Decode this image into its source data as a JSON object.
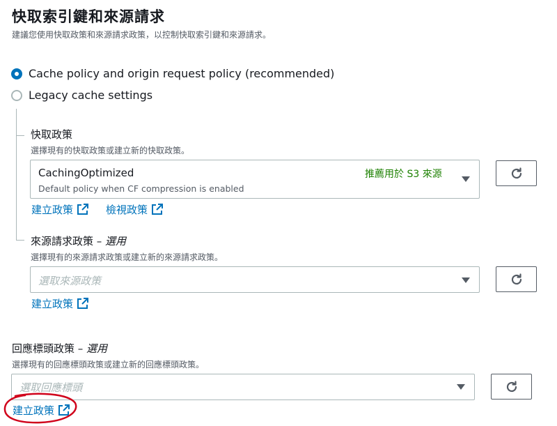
{
  "header": {
    "title": "快取索引鍵和來源請求",
    "description": "建議您使用快取政策和來源請求政策，以控制快取索引鍵和來源請求。"
  },
  "options": {
    "policy_label": "Cache policy and origin request policy (recommended)",
    "legacy_label": "Legacy cache settings",
    "selected": "policy"
  },
  "cache_policy": {
    "label": "快取政策",
    "description": "選擇現有的快取政策或建立新的快取政策。",
    "selected_name": "CachingOptimized",
    "selected_badge": "推薦用於 S3 來源",
    "selected_description": "Default policy when CF compression is enabled",
    "create_link": "建立政策",
    "view_link": "檢視政策"
  },
  "origin_request_policy": {
    "label": "來源請求政策 – ",
    "optional": "選用",
    "description": "選擇現有的來源請求政策或建立新的來源請求政策。",
    "placeholder": "選取來源政策",
    "create_link": "建立政策"
  },
  "response_headers_policy": {
    "label": "回應標頭政策 – ",
    "optional": "選用",
    "description": "選擇現有的回應標頭政策或建立新的回應標頭政策。",
    "placeholder": "選取回應標頭",
    "create_link": "建立政策"
  },
  "annotation": {
    "color": "#d0021b"
  },
  "colors": {
    "accent": "#0073bb",
    "success": "#1d8102"
  },
  "icons": {
    "refresh": "refresh-icon",
    "external": "external-link-icon",
    "dropdown": "caret-down-icon"
  }
}
